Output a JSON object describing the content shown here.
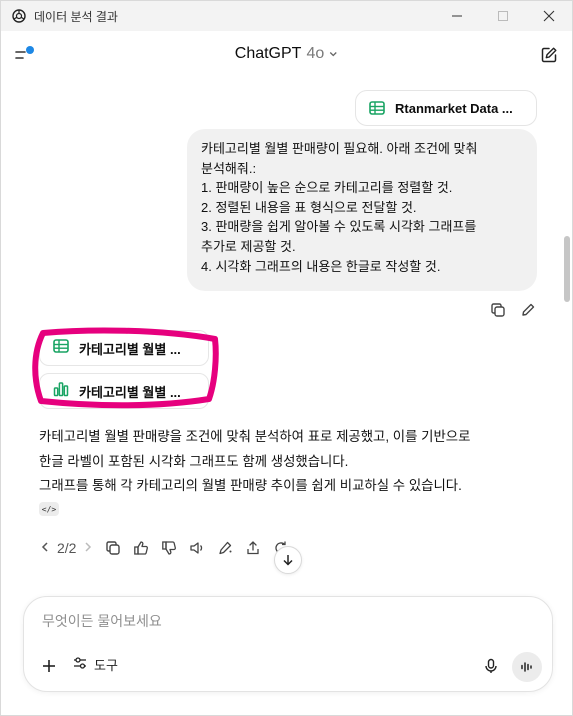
{
  "window": {
    "title": "데이터 분석 결과"
  },
  "header": {
    "model_name": "ChatGPT",
    "model_version": "4o"
  },
  "user_message": {
    "attachment_name": "Rtanmarket Data ...",
    "lines": [
      "카테고리별 월별 판매량이 필요해. 아래 조건에 맞춰",
      "분석해줘.:",
      "1. 판매량이 높은 순으로 카테고리를 정렬할 것.",
      "2. 정렬된 내용을 표 형식으로 전달할 것.",
      "3. 판매량을 쉽게 알아볼 수 있도록 시각화 그래프를",
      "추가로 제공할 것.",
      "4. 시각화 그래프의 내용은 한글로 작성할 것."
    ]
  },
  "assistant_message": {
    "results": [
      {
        "label": "카테고리별 월별 ...",
        "icon": "table-icon"
      },
      {
        "label": "카테고리별 월별 ...",
        "icon": "bar-chart-icon"
      }
    ],
    "lines": [
      "카테고리별 월별 판매량을 조건에 맞춰 분석하여 표로 제공했고, 이를 기반으로",
      "한글 라벨이 포함된 시각화 그래프도 함께 생성했습니다.",
      "그래프를 통해 각 카테고리의 월별 판매량 추이를 쉽게 비교하실 수 있습니다."
    ],
    "code_badge": "</>",
    "pager": "2/2"
  },
  "composer": {
    "placeholder": "무엇이든 물어보세요",
    "tools_label": "도구"
  },
  "colors": {
    "accent_blue": "#1e88e5",
    "sheet_green": "#19a463",
    "annotation_magenta": "#e6007e"
  }
}
